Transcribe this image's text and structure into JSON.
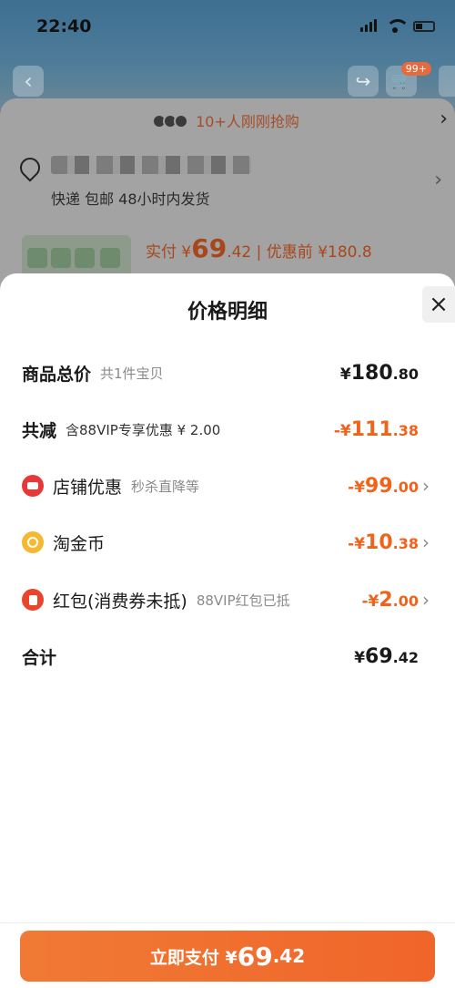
{
  "status_bar": {
    "time": "22:40"
  },
  "background": {
    "cart_badge": "99+",
    "rush_text": "10+人刚刚抢购",
    "shipping_text": "快递 包邮 48小时内发货",
    "price_label": "实付 ¥",
    "price_big": "69",
    "price_dec": ".42",
    "price_before": "| 优惠前 ¥180.8"
  },
  "sheet": {
    "title": "价格明细",
    "rows": [
      {
        "label": "商品总价",
        "sub": "共1件宝贝",
        "yen": "¥",
        "int": "180",
        "dec": ".80"
      },
      {
        "label": "共减",
        "sub": "含88VIP专享优惠 ¥ 2.00",
        "yen": "-¥",
        "int": "111",
        "dec": ".38"
      },
      {
        "label": "店铺优惠",
        "sub": "秒杀直降等",
        "yen": "-¥",
        "int": "99",
        "dec": ".00",
        "icon": "shop-icon"
      },
      {
        "label": "淘金币",
        "sub": "",
        "yen": "-¥",
        "int": "10",
        "dec": ".38",
        "icon": "coin-icon"
      },
      {
        "label": "红包(消费券未抵)",
        "sub": "88VIP红包已抵",
        "yen": "-¥",
        "int": "2",
        "dec": ".00",
        "icon": "red-packet-icon"
      },
      {
        "label": "合计",
        "sub": "",
        "yen": "¥",
        "int": "69",
        "dec": ".42"
      }
    ]
  },
  "pay_button": {
    "label": "立即支付 ¥",
    "int": "69",
    "dec": ".42"
  },
  "colors": {
    "accent": "#f0631a",
    "button": "#f0652a"
  }
}
